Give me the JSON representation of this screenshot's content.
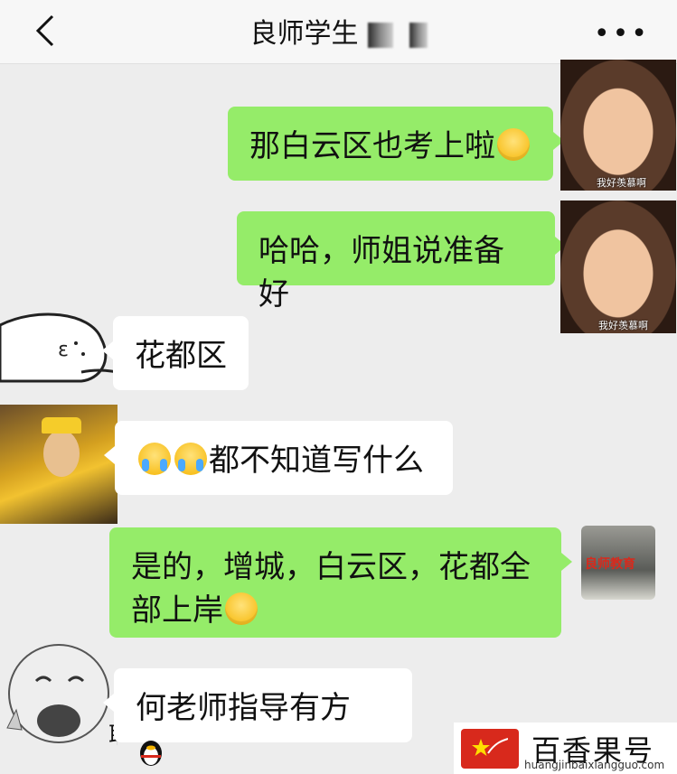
{
  "header": {
    "title": "良师学生",
    "back_icon": "chevron-left-icon",
    "more_icon": "more-dots-icon",
    "more_label": "•••"
  },
  "messages": [
    {
      "side": "right",
      "text": "那白云区也考上啦",
      "emoji": "smiling-emoji",
      "avatar_caption": "我好羡慕啊"
    },
    {
      "side": "right",
      "text": "哈哈，师姐说准备好",
      "avatar_caption": "我好羡慕啊"
    },
    {
      "side": "left",
      "text": "花都区"
    },
    {
      "side": "left",
      "text": "都不知道写什么",
      "emoji": "crying-laughing-emoji"
    },
    {
      "side": "right",
      "text_line1": "是的，增城，白云区，花都全",
      "text_line2": "部上岸",
      "emoji": "smirk-emoji",
      "avatar_label": "良师教育"
    },
    {
      "side": "left",
      "text": "何老师指导有方",
      "emoji": "penguin-icon",
      "avatar_caption": "耶!"
    }
  ],
  "watermark": {
    "text": "百香果号",
    "url": "huangjinbaixiangguo.com"
  },
  "colors": {
    "sent_bubble": "#95ec69",
    "received_bubble": "#ffffff",
    "background": "#ededed"
  }
}
